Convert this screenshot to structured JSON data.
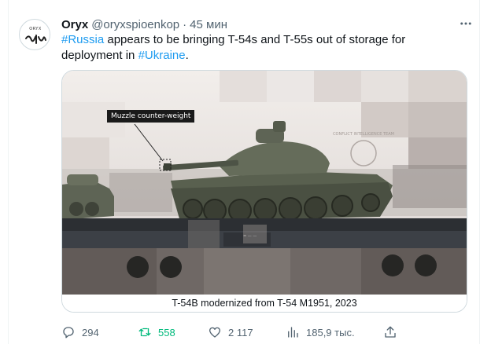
{
  "tweet": {
    "author_name": "Oryx",
    "author_handle": "@oryxspioenkop",
    "separator": "·",
    "time": "45 мин",
    "avatar_text": "ORYX",
    "text_hashtag_1": "#Russia",
    "text_part_1": " appears to be bringing T-54s and T-55s out of storage for deployment in ",
    "text_hashtag_2": "#Ukraine",
    "text_part_2": "."
  },
  "media": {
    "annotation_label": "Muzzle counter-weight",
    "watermark": "CONFLICT INTELLIGENCE TEAM",
    "caption": "T-54B modernized from T-54 M1951, 2023"
  },
  "actions": {
    "replies": "294",
    "retweets": "558",
    "likes": "2 117",
    "views": "185,9 тыс."
  },
  "colors": {
    "accent": "#1d9bf0",
    "retweet_active": "#00ba7c",
    "secondary_text": "#536471"
  }
}
